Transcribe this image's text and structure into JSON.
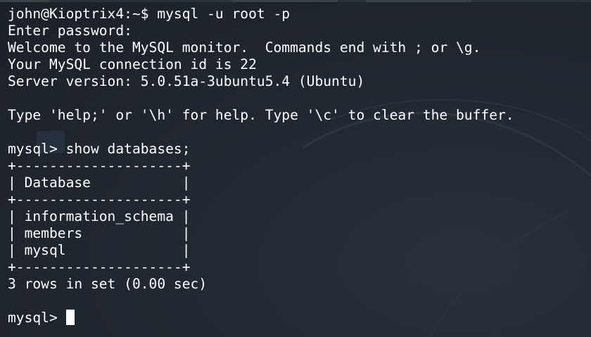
{
  "terminal": {
    "lines": [
      "john@Kioptrix4:~$ mysql -u root -p",
      "Enter password: ",
      "Welcome to the MySQL monitor.  Commands end with ; or \\g.",
      "Your MySQL connection id is 22",
      "Server version: 5.0.51a-3ubuntu5.4 (Ubuntu)",
      "",
      "Type 'help;' or '\\h' for help. Type '\\c' to clear the buffer.",
      "",
      "mysql> show databases;",
      "+--------------------+",
      "| Database           |",
      "+--------------------+",
      "| information_schema |",
      "| members            |",
      "| mysql              |",
      "+--------------------+",
      "3 rows in set (0.00 sec)",
      ""
    ],
    "prompt": "mysql> ",
    "background_color": "#222831",
    "text_color": "#ffffff"
  }
}
